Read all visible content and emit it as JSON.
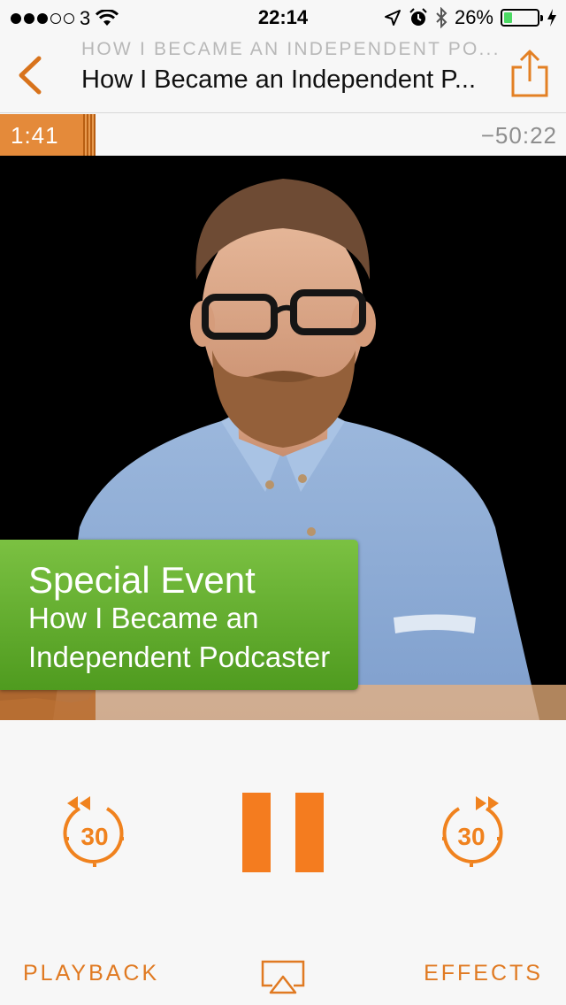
{
  "status_bar": {
    "carrier": "3",
    "time": "22:14",
    "battery": "26%",
    "battery_level": 0.26,
    "battery_color": "#4cd964"
  },
  "nav": {
    "back_icon": "chevron-left-icon",
    "subtitle": "HOW I BECAME AN INDEPENDENT PO...",
    "title": "How I Became an Independent P...",
    "share_icon": "share-icon"
  },
  "progress": {
    "elapsed": "1:41",
    "remaining": "−50:22"
  },
  "artwork": {
    "badge_title": "Special Event",
    "badge_line1": "How I Became an",
    "badge_line2": "Independent Podcaster",
    "badge_color": "#5fae2c"
  },
  "controls": {
    "skip_back_label": "30",
    "skip_forward_label": "30",
    "pause_icon": "pause-icon",
    "accent": "#f47c1f"
  },
  "bottom": {
    "playback_label": "PLAYBACK",
    "effects_label": "EFFECTS",
    "airplay_icon": "airplay-icon"
  }
}
